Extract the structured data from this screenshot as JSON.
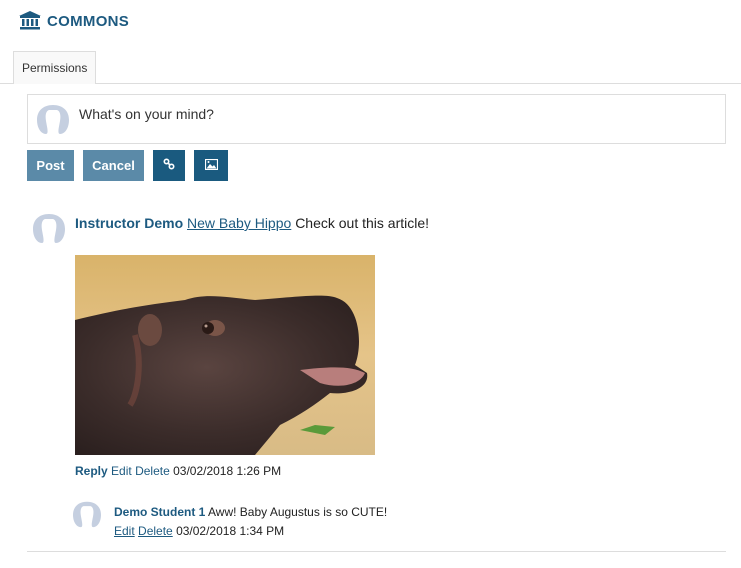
{
  "header": {
    "icon": "institution-icon",
    "title": "COMMONS"
  },
  "tabs": [
    {
      "label": "Permissions"
    }
  ],
  "composer": {
    "placeholder": "What's on your mind?",
    "buttons": {
      "post": "Post",
      "cancel": "Cancel",
      "link_icon": "link-icon",
      "image_icon": "image-icon"
    }
  },
  "post": {
    "author": "Instructor Demo",
    "link_text": "New Baby Hippo",
    "text": "Check out this article!",
    "image_alt": "Baby hippo photo",
    "actions": {
      "reply": "Reply",
      "edit": "Edit",
      "delete": "Delete"
    },
    "timestamp": "03/02/2018 1:26 PM",
    "comments": [
      {
        "author": "Demo Student 1",
        "text": "Aww! Baby Augustus is so CUTE!",
        "actions": {
          "edit": "Edit",
          "delete": "Delete"
        },
        "timestamp": "03/02/2018 1:34 PM"
      }
    ]
  },
  "colors": {
    "brand": "#1d5a80",
    "button_light": "#5b8aa8",
    "button_dark": "#1a5a7f",
    "avatar": "#c5cfe0",
    "border": "#dddddd"
  }
}
